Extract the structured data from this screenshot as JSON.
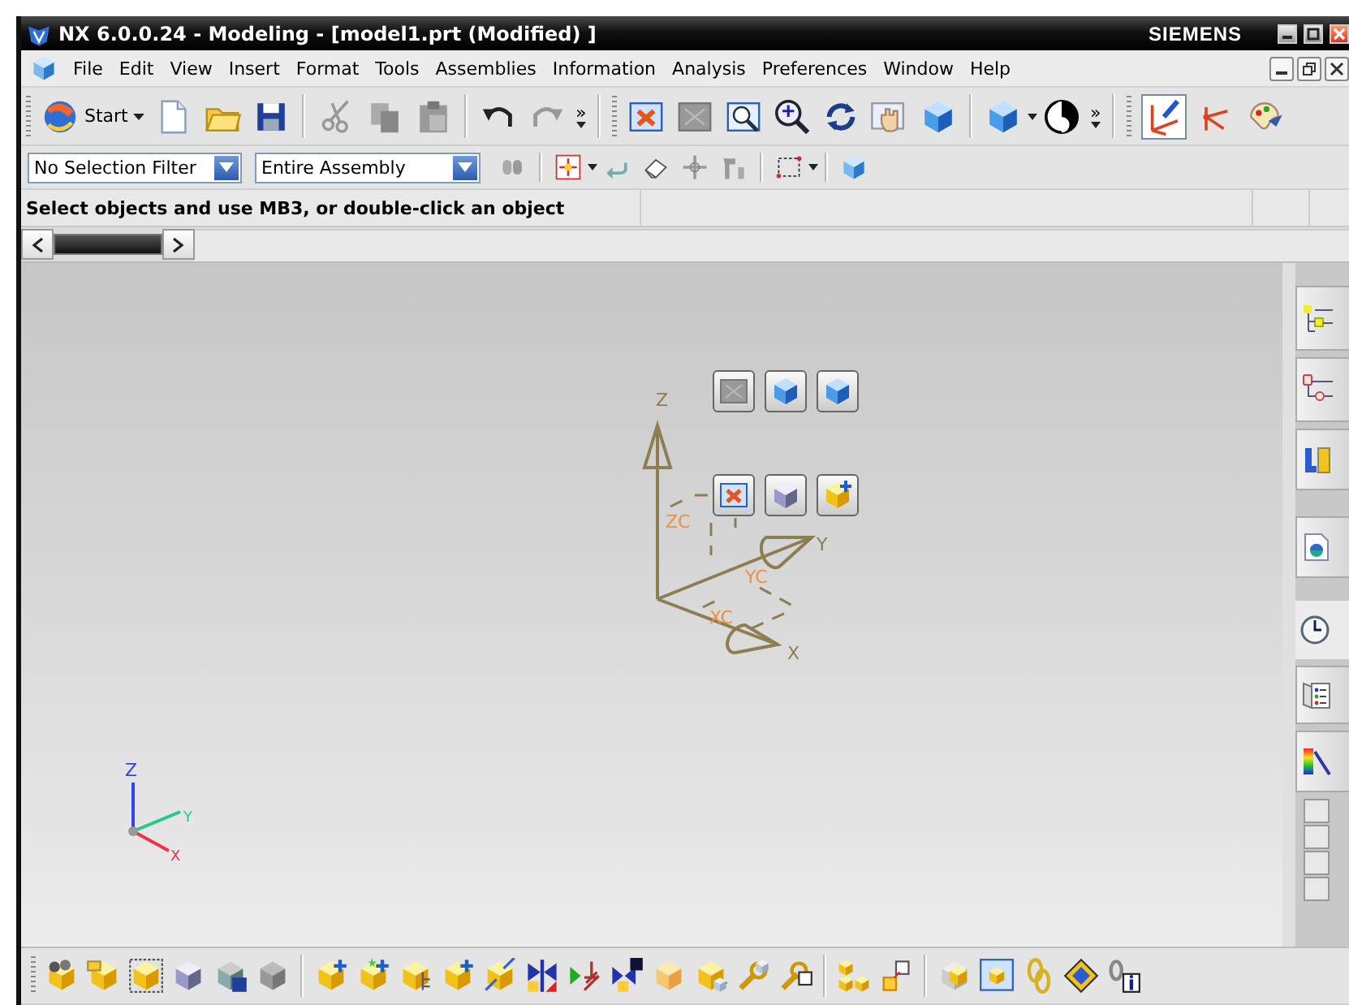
{
  "window": {
    "title": "NX 6.0.0.24 - Modeling - [model1.prt (Modified) ]",
    "brand": "SIEMENS"
  },
  "menu": [
    "File",
    "Edit",
    "View",
    "Insert",
    "Format",
    "Tools",
    "Assemblies",
    "Information",
    "Analysis",
    "Preferences",
    "Window",
    "Help"
  ],
  "toolbar": {
    "start": "Start",
    "overflow": [
      "»",
      "»"
    ],
    "wcs_pressed": true
  },
  "selection_bar": {
    "filter": "No Selection Filter",
    "scope": "Entire Assembly"
  },
  "status_bar": {
    "prompt": "Select objects and use MB3, or double-click an object"
  },
  "viewport": {
    "wcs": {
      "z": "Z",
      "zc": "ZC",
      "y": "Y",
      "yc": "YC",
      "x": "X",
      "xc": "XC"
    },
    "triad": {
      "z": "Z",
      "y": "Y",
      "x": "X"
    }
  }
}
